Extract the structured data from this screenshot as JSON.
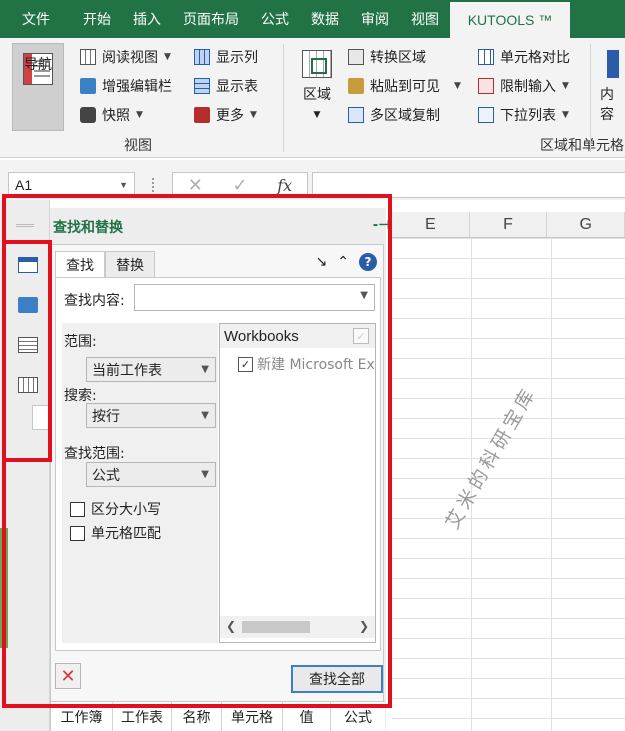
{
  "ribbon_tabs": [
    "文件",
    "开始",
    "插入",
    "页面布局",
    "公式",
    "数据",
    "审阅",
    "视图",
    "KUTOOLS ™"
  ],
  "ribbon": {
    "nav_label": "导航",
    "view_group": {
      "items": [
        "阅读视图",
        "增强编辑栏",
        "快照",
        "显示列",
        "显示表",
        "更多"
      ],
      "group_label": "视图"
    },
    "range_group": {
      "region_label": "区域",
      "items": [
        "转换区域",
        "粘贴到可见",
        "多区域复制",
        "单元格对比",
        "限制输入",
        "下拉列表"
      ],
      "group_label": "区域和单元格",
      "content_label": "内容"
    }
  },
  "formula_bar": {
    "name_box": "A1",
    "cancel_symbol": "✕",
    "enter_symbol": "✓",
    "fx_symbol": "fx"
  },
  "columns": [
    "E",
    "F",
    "G"
  ],
  "pane": {
    "title": "查找和替换",
    "tabs": [
      "查找",
      "替换"
    ],
    "find_label": "查找内容:",
    "find_value": "",
    "scope_label": "范围:",
    "scope_value": "当前工作表",
    "search_label": "搜索:",
    "search_value": "按行",
    "lookin_label": "查找范围:",
    "lookin_value": "公式",
    "match_case": "区分大小写",
    "match_cell": "单元格匹配",
    "tree_header": "Workbooks",
    "tree_item": "新建 Microsoft Excel",
    "find_all": "查找全部",
    "result_columns": [
      "工作簿",
      "工作表",
      "名称",
      "单元格",
      "值",
      "公式"
    ]
  },
  "watermark": "艾米的科研宝库",
  "colors": {
    "excel_green": "#217346",
    "highlight_red": "#e01020",
    "kutools_blue": "#2a5da8"
  }
}
